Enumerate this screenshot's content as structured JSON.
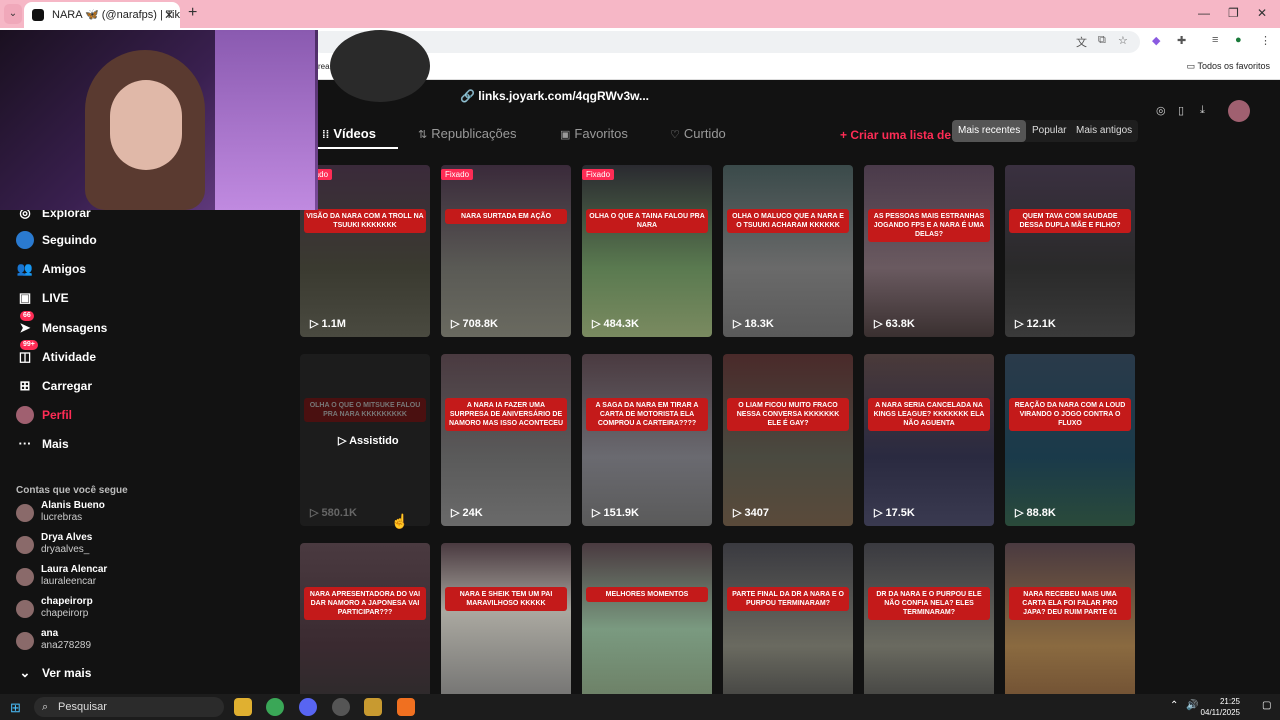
{
  "browser": {
    "tab_title": "NARA 🦋 (@narafps) | TikTok",
    "new_tab": "+",
    "close": "✕",
    "bookmarks_label": "Todos os favoritos",
    "address_fragment": "rea..."
  },
  "profile": {
    "link": "links.joyark.com/4qgRWv3w...",
    "tabs": [
      "Vídeos",
      "Republicações",
      "Favoritos",
      "Curtido"
    ],
    "create_list": "Criar uma lista de re",
    "sort": [
      "Mais recentes",
      "Popular",
      "Mais antigos"
    ]
  },
  "sidebar": {
    "nav": [
      {
        "label": "Explorar",
        "icon": "compass-icon"
      },
      {
        "label": "Seguindo",
        "icon": "following-icon"
      },
      {
        "label": "Amigos",
        "icon": "friends-icon"
      },
      {
        "label": "LIVE",
        "icon": "live-icon"
      },
      {
        "label": "Mensagens",
        "icon": "messages-icon",
        "badge": "66"
      },
      {
        "label": "Atividade",
        "icon": "activity-icon",
        "badge": "99+"
      },
      {
        "label": "Carregar",
        "icon": "upload-icon"
      },
      {
        "label": "Perfil",
        "icon": "profile-avatar-icon"
      },
      {
        "label": "Mais",
        "icon": "more-icon"
      }
    ],
    "following_header": "Contas que você segue",
    "following": [
      {
        "name": "Alanis Bueno",
        "user": "lucrebras"
      },
      {
        "name": "Drya Alves",
        "user": "dryaalves_"
      },
      {
        "name": "Laura Alencar",
        "user": "lauraleencar"
      },
      {
        "name": "chapeirorp",
        "user": "chapeirorp"
      },
      {
        "name": "ana",
        "user": "ana278289"
      }
    ],
    "see_more": "Ver mais"
  },
  "videos": [
    {
      "caption": "VISÃO DA NARA COM A TROLL NA TSUUKI KKKKKKK",
      "views": "1.1M",
      "pinned": "Fixado"
    },
    {
      "caption": "NARA SURTADA EM AÇÃO",
      "views": "708.8K",
      "pinned": "Fixado"
    },
    {
      "caption": "OLHA O QUE A TAINA FALOU PRA NARA",
      "views": "484.3K",
      "pinned": "Fixado"
    },
    {
      "caption": "OLHA O MALUCO QUE A NARA E O TSUUKI ACHARAM KKKKKK",
      "views": "18.3K"
    },
    {
      "caption": "AS PESSOAS MAIS ESTRANHAS JOGANDO FPS E A NARA É UMA DELAS?",
      "views": "63.8K"
    },
    {
      "caption": "QUEM TAVA COM SAUDADE DESSA DUPLA MÃE E FILHO?",
      "views": "12.1K"
    },
    {
      "caption": "OLHA O QUE O MITSUKE FALOU PRA NARA KKKKKKKKK",
      "views": "580.1K",
      "watched": "Assistido"
    },
    {
      "caption": "A NARA IA FAZER UMA SURPRESA DE ANIVERSÁRIO DE NAMORO MAS ISSO ACONTECEU",
      "views": "24K"
    },
    {
      "caption": "A SAGA DA NARA EM TIRAR A CARTA DE MOTORISTA ELA COMPROU A CARTEIRA????",
      "views": "151.9K"
    },
    {
      "caption": "O LIAM FICOU MUITO FRACO NESSA CONVERSA KKKKKKK ELE É GAY?",
      "views": "3407"
    },
    {
      "caption": "A NARA SERIA CANCELADA NA KINGS LEAGUE? KKKKKKK ELA NÃO AGUENTA",
      "views": "17.5K"
    },
    {
      "caption": "REAÇÃO DA NARA COM A LOUD VIRANDO O JOGO CONTRA O FLUXO",
      "views": "88.8K"
    },
    {
      "caption": "NARA APRESENTADORA DO VAI DAR NAMORO A JAPONESA VAI PARTICIPAR???",
      "views": ""
    },
    {
      "caption": "NARA E SHEIK TEM UM PAI MARAVILHOSO KKKKK",
      "views": ""
    },
    {
      "caption": "MELHORES MOMENTOS",
      "views": ""
    },
    {
      "caption": "PARTE FINAL DA DR A NARA E O PURPOU TERMINARAM?",
      "views": ""
    },
    {
      "caption": "DR DA NARA E O PURPOU ELE NÃO CONFIA NELA? ELES TERMINARAM?",
      "views": ""
    },
    {
      "caption": "NARA RECEBEU MAIS UMA CARTA ELA FOI FALAR PRO JAPA? DEU RUIM PARTE 01",
      "views": ""
    }
  ],
  "taskbar": {
    "search": "Pesquisar",
    "time": "21:25",
    "date": "04/11/2025"
  }
}
